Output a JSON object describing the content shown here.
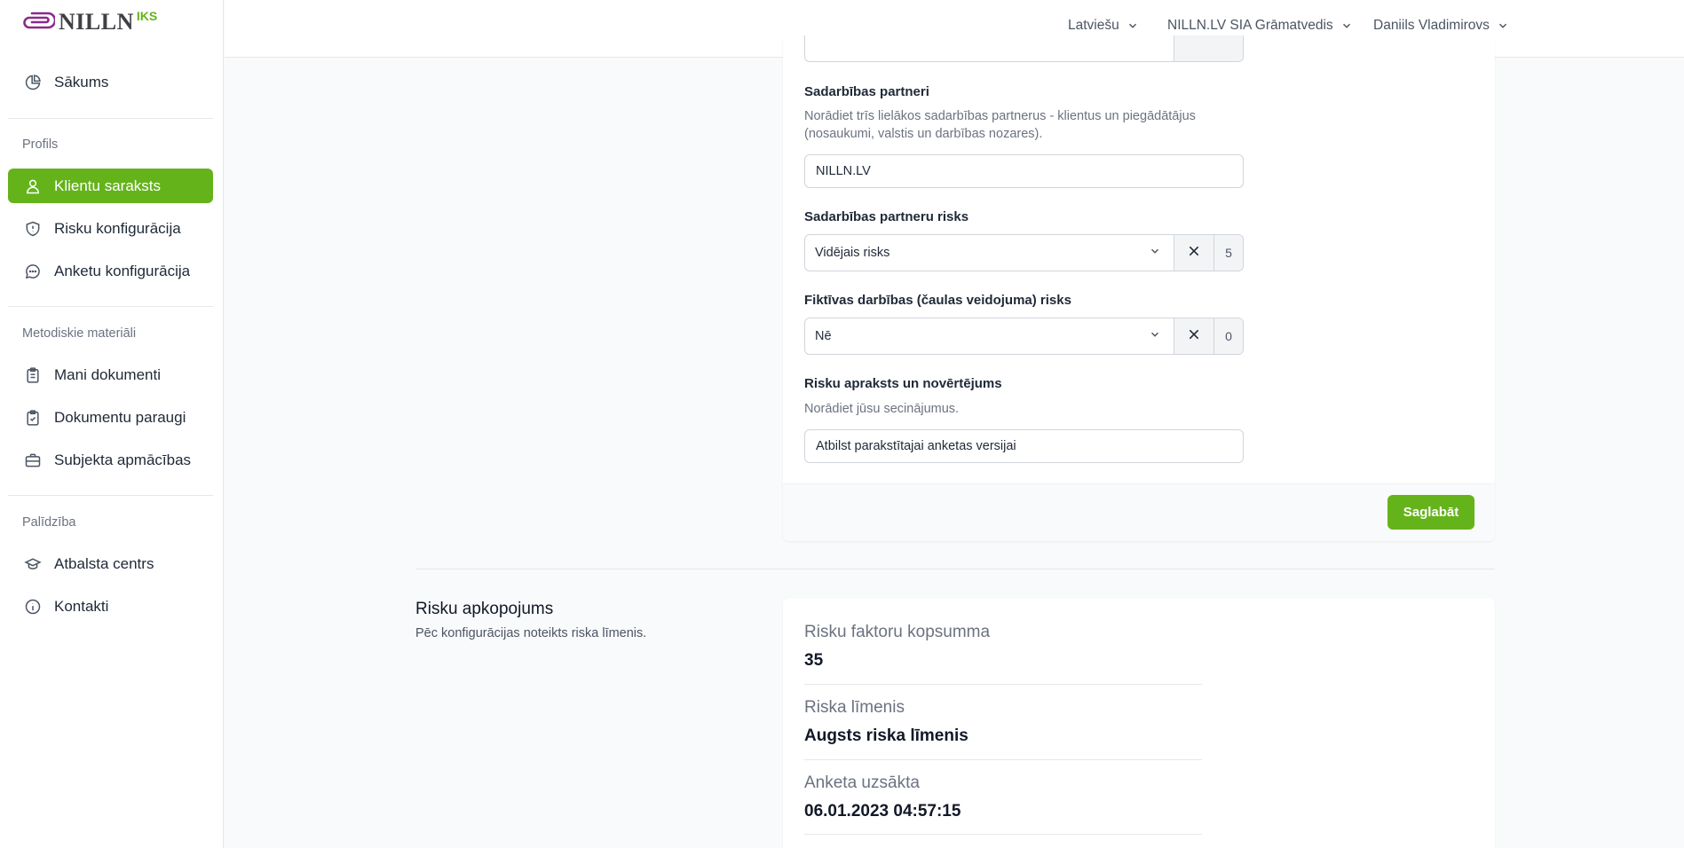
{
  "brand": {
    "name": "NILLN",
    "suffix": "IKS",
    "accent": "#65b31b",
    "logo_color": "#8b2a8c"
  },
  "sidebar": {
    "home": {
      "label": "Sākums",
      "icon": "pie-chart-icon"
    },
    "profile_heading": "Profils",
    "profile_items": [
      {
        "label": "Klientu saraksts",
        "icon": "user-icon",
        "active": true
      },
      {
        "label": "Risku konfigurācija",
        "icon": "shield-icon"
      },
      {
        "label": "Anketu konfigurācija",
        "icon": "chat-bubble-icon"
      }
    ],
    "materials_heading": "Metodiskie materiāli",
    "materials_items": [
      {
        "label": "Mani dokumenti",
        "icon": "clipboard-list-icon"
      },
      {
        "label": "Dokumentu paraugi",
        "icon": "clipboard-check-icon"
      },
      {
        "label": "Subjekta apmācības",
        "icon": "briefcase-icon"
      }
    ],
    "help_heading": "Palīdzība",
    "help_items": [
      {
        "label": "Atbalsta centrs",
        "icon": "graduation-cap-icon"
      },
      {
        "label": "Kontakti",
        "icon": "info-icon"
      }
    ]
  },
  "header": {
    "language": "Latviešu",
    "company": "NILLN.LV SIA Grāmatvedis",
    "user": "Daniils Vladimirovs"
  },
  "form": {
    "partners": {
      "label": "Sadarbības partneri",
      "help": "Norādiet trīs lielākos sadarbības partnerus - klientus un piegādātājus (nosaukumi, valstis un darbības nozares).",
      "value": "NILLN.LV"
    },
    "partners_risk": {
      "label": "Sadarbības partneru risks",
      "selected": "Vidējais risks",
      "score": "5"
    },
    "shell_risk": {
      "label": "Fiktīvas darbības (čaulas veidojuma) risks",
      "selected": "Nē",
      "score": "0"
    },
    "risk_description": {
      "label": "Risku apraksts un novērtējums",
      "help": "Norādiet jūsu secinājumus.",
      "value": "Atbilst parakstītajai anketas versijai"
    },
    "save_label": "Saglabāt"
  },
  "summary": {
    "title": "Risku apkopojums",
    "description": "Pēc konfigurācijas noteikts riska līmenis.",
    "total_label": "Risku faktoru kopsumma",
    "total_value": "35",
    "level_label": "Riska līmenis",
    "level_value": "Augsts riska līmenis",
    "started_label": "Anketa uzsākta",
    "started_value": "06.01.2023 04:57:15"
  }
}
